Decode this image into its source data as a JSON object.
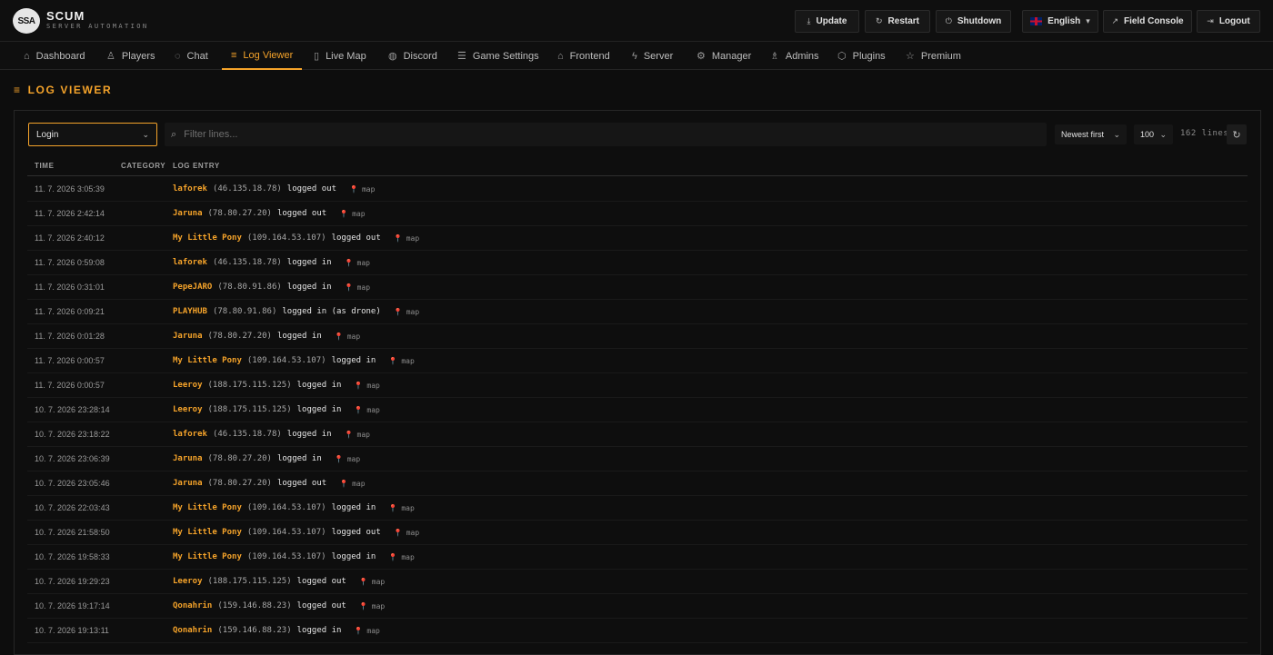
{
  "brand": {
    "logo": "SSA",
    "name": "SCUM",
    "subtitle": "SERVER AUTOMATION"
  },
  "toolbar": {
    "update": "Update",
    "restart": "Restart",
    "shutdown": "Shutdown",
    "language": "English",
    "field_console": "Field Console",
    "logout": "Logout"
  },
  "nav": [
    {
      "label": "Dashboard",
      "icon": "home-icon"
    },
    {
      "label": "Players",
      "icon": "user-icon"
    },
    {
      "label": "Chat",
      "icon": "chat-icon"
    },
    {
      "label": "Log Viewer",
      "icon": "list-icon",
      "active": true
    },
    {
      "label": "Live Map",
      "icon": "map-icon"
    },
    {
      "label": "Discord",
      "icon": "discord-icon"
    },
    {
      "label": "Game Settings",
      "icon": "sliders-icon"
    },
    {
      "label": "Frontend",
      "icon": "house-icon"
    },
    {
      "label": "Server",
      "icon": "bolt-icon"
    },
    {
      "label": "Manager",
      "icon": "gear-icon"
    },
    {
      "label": "Admins",
      "icon": "admin-icon"
    },
    {
      "label": "Plugins",
      "icon": "package-icon"
    },
    {
      "label": "Premium",
      "icon": "star-icon"
    }
  ],
  "page": {
    "title": "LOG VIEWER"
  },
  "controls": {
    "log_type": "Login",
    "filter_placeholder": "Filter lines...",
    "sort": "Newest first",
    "limit": "100",
    "line_count": "162 lines"
  },
  "table": {
    "headers": {
      "time": "TIME",
      "category": "CATEGORY",
      "entry": "LOG ENTRY"
    },
    "rows": [
      {
        "time": "11. 7. 2026 3:05:39",
        "player": "laforek",
        "ip": "(46.135.18.78)",
        "action": "logged out",
        "map": "map"
      },
      {
        "time": "11. 7. 2026 2:42:14",
        "player": "Jaruna",
        "ip": "(78.80.27.20)",
        "action": "logged out",
        "map": "map"
      },
      {
        "time": "11. 7. 2026 2:40:12",
        "player": "My Little Pony",
        "ip": "(109.164.53.107)",
        "action": "logged out",
        "map": "map"
      },
      {
        "time": "11. 7. 2026 0:59:08",
        "player": "laforek",
        "ip": "(46.135.18.78)",
        "action": "logged in",
        "map": "map"
      },
      {
        "time": "11. 7. 2026 0:31:01",
        "player": "PepeJARO",
        "ip": "(78.80.91.86)",
        "action": "logged in",
        "map": "map"
      },
      {
        "time": "11. 7. 2026 0:09:21",
        "player": "PLAYHUB",
        "ip": "(78.80.91.86)",
        "action": "logged in (as drone)",
        "map": "map"
      },
      {
        "time": "11. 7. 2026 0:01:28",
        "player": "Jaruna",
        "ip": "(78.80.27.20)",
        "action": "logged in",
        "map": "map"
      },
      {
        "time": "11. 7. 2026 0:00:57",
        "player": "My Little Pony",
        "ip": "(109.164.53.107)",
        "action": "logged in",
        "map": "map"
      },
      {
        "time": "11. 7. 2026 0:00:57",
        "player": "Leeroy",
        "ip": "(188.175.115.125)",
        "action": "logged in",
        "map": "map"
      },
      {
        "time": "10. 7. 2026 23:28:14",
        "player": "Leeroy",
        "ip": "(188.175.115.125)",
        "action": "logged in",
        "map": "map"
      },
      {
        "time": "10. 7. 2026 23:18:22",
        "player": "laforek",
        "ip": "(46.135.18.78)",
        "action": "logged in",
        "map": "map"
      },
      {
        "time": "10. 7. 2026 23:06:39",
        "player": "Jaruna",
        "ip": "(78.80.27.20)",
        "action": "logged in",
        "map": "map"
      },
      {
        "time": "10. 7. 2026 23:05:46",
        "player": "Jaruna",
        "ip": "(78.80.27.20)",
        "action": "logged out",
        "map": "map"
      },
      {
        "time": "10. 7. 2026 22:03:43",
        "player": "My Little Pony",
        "ip": "(109.164.53.107)",
        "action": "logged in",
        "map": "map"
      },
      {
        "time": "10. 7. 2026 21:58:50",
        "player": "My Little Pony",
        "ip": "(109.164.53.107)",
        "action": "logged out",
        "map": "map"
      },
      {
        "time": "10. 7. 2026 19:58:33",
        "player": "My Little Pony",
        "ip": "(109.164.53.107)",
        "action": "logged in",
        "map": "map"
      },
      {
        "time": "10. 7. 2026 19:29:23",
        "player": "Leeroy",
        "ip": "(188.175.115.125)",
        "action": "logged out",
        "map": "map"
      },
      {
        "time": "10. 7. 2026 19:17:14",
        "player": "Qonahrin",
        "ip": "(159.146.88.23)",
        "action": "logged out",
        "map": "map"
      },
      {
        "time": "10. 7. 2026 19:13:11",
        "player": "Qonahrin",
        "ip": "(159.146.88.23)",
        "action": "logged in",
        "map": "map"
      }
    ]
  }
}
